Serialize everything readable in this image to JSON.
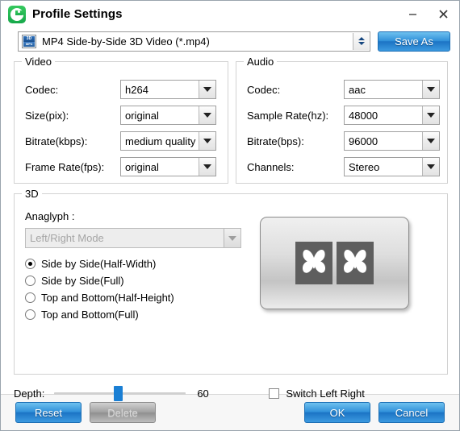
{
  "window": {
    "title": "Profile Settings",
    "app_icon": "profile-app-icon",
    "minimize_label": "–",
    "close_label": "✕"
  },
  "format": {
    "icon": "mp4-3d-file-icon",
    "icon_top_text": "3D",
    "icon_bottom_text": "MP4",
    "value": "MP4 Side-by-Side 3D Video (*.mp4)",
    "spinner": "up-down-spinner",
    "save_as_label": "Save As"
  },
  "video": {
    "legend": "Video",
    "fields": [
      {
        "label": "Codec:",
        "value": "h264"
      },
      {
        "label": "Size(pix):",
        "value": "original"
      },
      {
        "label": "Bitrate(kbps):",
        "value": "medium quality"
      },
      {
        "label": "Frame Rate(fps):",
        "value": "original"
      }
    ]
  },
  "audio": {
    "legend": "Audio",
    "fields": [
      {
        "label": "Codec:",
        "value": "aac"
      },
      {
        "label": "Sample Rate(hz):",
        "value": "48000"
      },
      {
        "label": "Bitrate(bps):",
        "value": "96000"
      },
      {
        "label": "Channels:",
        "value": "Stereo"
      }
    ]
  },
  "three_d": {
    "legend": "3D",
    "anaglyph_label": "Anaglyph :",
    "anaglyph_value": "Left/Right Mode",
    "anaglyph_disabled": true,
    "modes": [
      {
        "label": "Side by Side(Half-Width)",
        "checked": true
      },
      {
        "label": "Side by Side(Full)",
        "checked": false
      },
      {
        "label": "Top and Bottom(Half-Height)",
        "checked": false
      },
      {
        "label": "Top and Bottom(Full)",
        "checked": false
      }
    ],
    "preview": {
      "name": "side-by-side-butterfly-preview",
      "panes": 2
    },
    "depth_label": "Depth:",
    "depth_value": "60",
    "depth_percent": 45,
    "switch_label": "Switch Left Right",
    "switch_checked": false
  },
  "footer": {
    "reset_label": "Reset",
    "delete_label": "Delete",
    "delete_disabled": true,
    "ok_label": "OK",
    "cancel_label": "Cancel"
  },
  "colors": {
    "accent_blue": "#1b73c4",
    "slider_blue": "#1a7fd4",
    "app_green": "#16a84a",
    "disabled_gray": "#9f9f9f"
  }
}
